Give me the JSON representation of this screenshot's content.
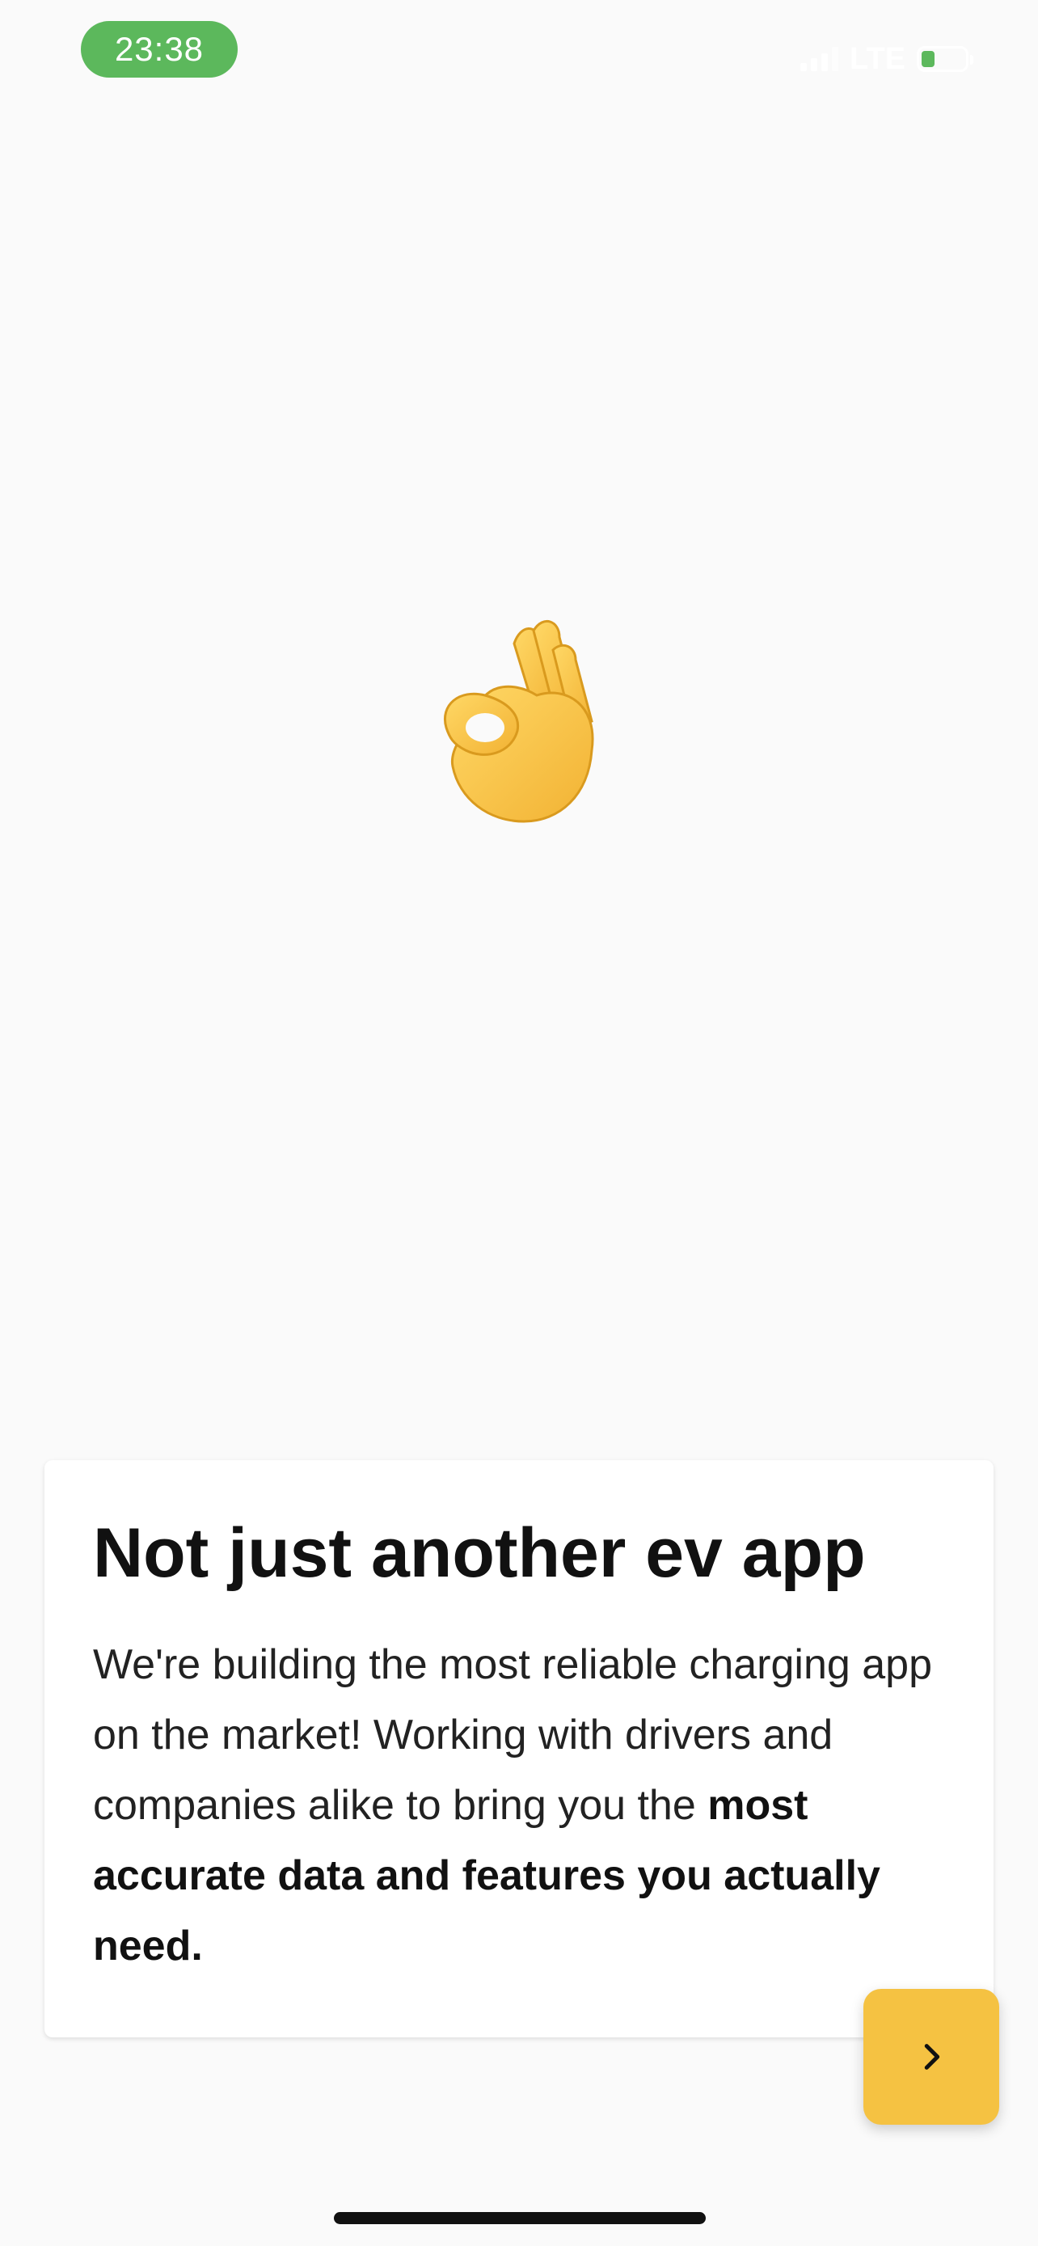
{
  "status_bar": {
    "time": "23:38",
    "network": "LTE",
    "battery_level": 0.3,
    "time_pill_color": "#5cb85c"
  },
  "hero": {
    "emoji": "👌",
    "icon": "ok-hand-icon"
  },
  "card": {
    "title": "Not just another ev app",
    "body_regular": "We're building the most reliable charging app on the market! Working with drivers and companies alike to bring you the ",
    "body_bold": "most accurate data and features you actually need."
  },
  "next_button": {
    "icon": "chevron-right-icon",
    "color": "#f5c242"
  }
}
